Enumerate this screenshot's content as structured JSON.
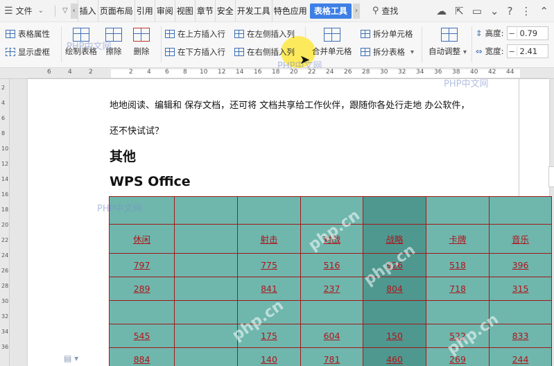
{
  "menubar": {
    "file_label": "文件",
    "tabs": [
      "插入",
      "页面布局",
      "引用",
      "审阅",
      "视图",
      "章节",
      "安全",
      "开发工具",
      "特色应用",
      "表格工具"
    ],
    "active_tab": "表格工具",
    "search_label": "查找"
  },
  "ribbon": {
    "table_props": "表格属性",
    "show_gridlines": "显示虚框",
    "draw_table": "绘制表格",
    "erase": "擦除",
    "delete": "删除",
    "insert_row_above": "在上方插入行",
    "insert_row_below": "在下方插入行",
    "insert_col_left": "在左侧插入列",
    "insert_col_right": "在右侧插入列",
    "merge_cells": "合并单元格",
    "split_cells": "拆分单元格",
    "split_table": "拆分表格",
    "auto_fit": "自动调整",
    "height_label": "高度:",
    "height_value": "0.79",
    "width_label": "宽度:",
    "width_value": "2.41"
  },
  "ruler": {
    "ticks": [
      "6",
      "4",
      "2",
      "2",
      "4",
      "6",
      "8",
      "10",
      "12",
      "14",
      "16",
      "18",
      "20",
      "22",
      "24",
      "26",
      "28",
      "30",
      "32",
      "34",
      "36",
      "38",
      "40",
      "42",
      "44"
    ],
    "vticks": [
      "2",
      "4",
      "6",
      "8",
      "10",
      "12",
      "14",
      "16",
      "18",
      "20",
      "22",
      "24",
      "26",
      "28",
      "30",
      "32",
      "34",
      "36"
    ]
  },
  "document": {
    "para1": "地地阅读、编辑和  保存文档，还可将  文档共享给工作伙伴，跟随你各处行走地  办公软件，",
    "para2": "还不快试试？",
    "heading1": "其他",
    "heading2": "WPS Office"
  },
  "table": {
    "rows": [
      [
        "",
        "",
        "",
        "",
        "",
        "",
        ""
      ],
      [
        "休闲",
        "",
        "射击",
        "对战",
        "战略",
        "卡牌",
        "音乐"
      ],
      [
        "797",
        "",
        "775",
        "516",
        "926",
        "518",
        "396"
      ],
      [
        "289",
        "",
        "841",
        "237",
        "804",
        "718",
        "315"
      ],
      [
        "",
        "",
        "",
        "",
        "",
        "",
        ""
      ],
      [
        "545",
        "",
        "175",
        "604",
        "150",
        "522",
        "833"
      ],
      [
        "884",
        "",
        "140",
        "781",
        "460",
        "269",
        "244"
      ]
    ]
  },
  "watermarks": {
    "site": "php.cn",
    "site_cn": "PHP中文网"
  }
}
